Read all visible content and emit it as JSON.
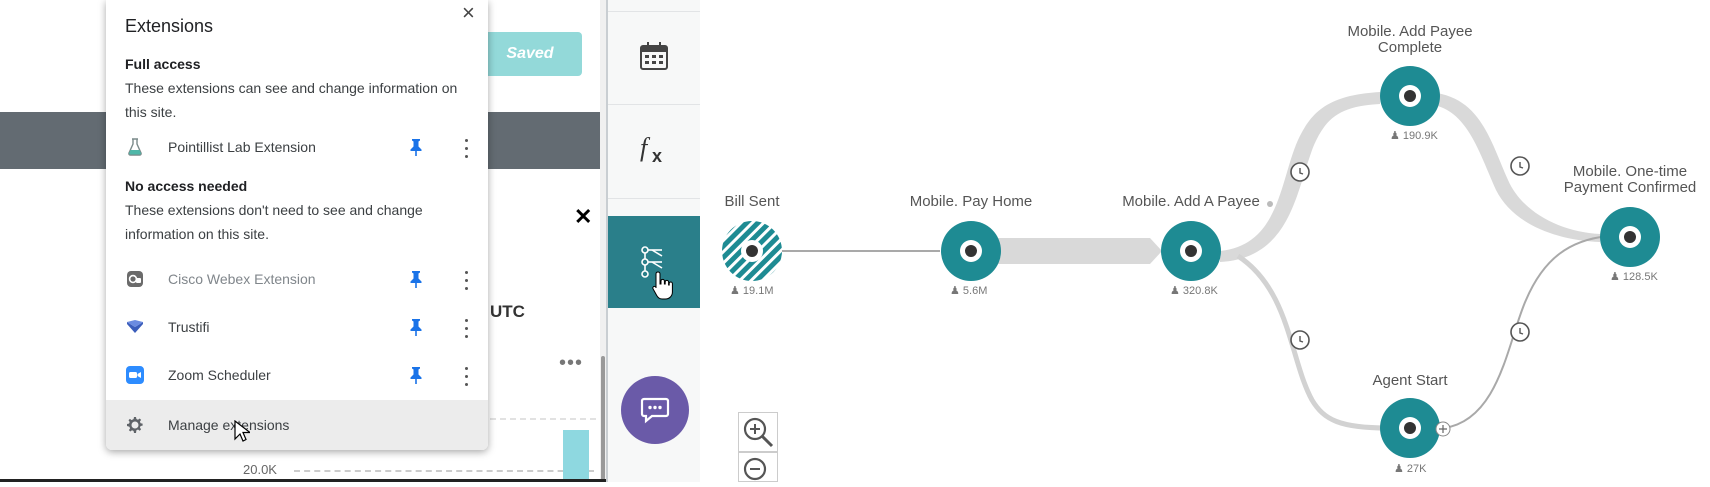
{
  "app": {
    "saved_label": "Saved",
    "timezone_label": "UTC",
    "more_label": "•••",
    "axis_tick_label": "20.0K",
    "close_label": "✕"
  },
  "extensions_popup": {
    "title": "Extensions",
    "close_label": "×",
    "full_access": {
      "title": "Full access",
      "description": "These extensions can see and change information on this site.",
      "items": [
        {
          "name": "Pointillist Lab Extension",
          "icon": "flask-icon",
          "pinned": true
        }
      ]
    },
    "no_access": {
      "title": "No access needed",
      "description": "These extensions don't need to see and change information on this site.",
      "items": [
        {
          "name": "Cisco Webex Extension",
          "icon": "webex-icon",
          "pinned": true
        },
        {
          "name": "Trustifi",
          "icon": "trustifi-icon",
          "pinned": true
        },
        {
          "name": "Zoom Scheduler",
          "icon": "zoom-icon",
          "pinned": true
        }
      ]
    },
    "manage_label": "Manage extensions",
    "colors": {
      "pin": "#1a73e8",
      "zoom": "#2d8cff",
      "trustifi": "#3b5dbb"
    }
  },
  "rail": {
    "items": [
      {
        "icon": "calendar-icon"
      },
      {
        "icon": "function-icon",
        "label": "fx"
      },
      {
        "icon": "journey-tree-icon",
        "active": true
      },
      {
        "icon": "chat-icon"
      }
    ],
    "colors": {
      "active": "#2a7f8a",
      "chat": "#6a5aa8"
    }
  },
  "flow": {
    "nodes": [
      {
        "id": "bill-sent",
        "label": "Bill Sent",
        "count": "19.1M"
      },
      {
        "id": "pay-home",
        "label": "Mobile. Pay Home",
        "count": "5.6M"
      },
      {
        "id": "add-payee",
        "label": "Mobile. Add A Payee",
        "count": "320.8K"
      },
      {
        "id": "add-payee-complete",
        "label_lines": [
          "Mobile. Add Payee",
          "Complete"
        ],
        "count": "190.9K"
      },
      {
        "id": "agent-start",
        "label": "Agent Start",
        "count": "27K"
      },
      {
        "id": "payment-confirmed",
        "label_lines": [
          "Mobile. One-time",
          "Payment Confirmed"
        ],
        "count": "128.5K"
      }
    ],
    "colors": {
      "node": "#1e8b93",
      "path": "#d9d9d9",
      "line": "#a9a9a9"
    }
  }
}
